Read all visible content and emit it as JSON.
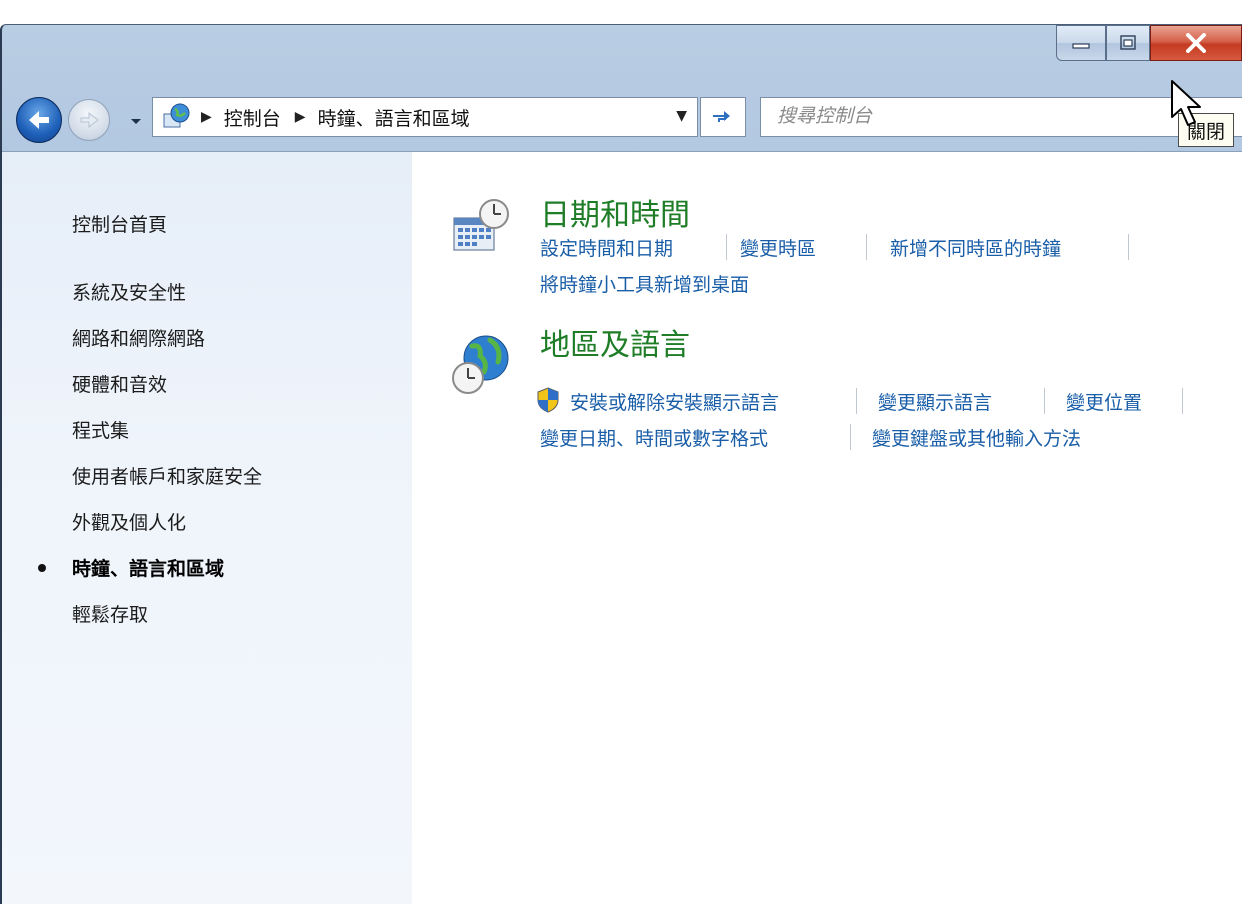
{
  "breadcrumb": {
    "items": [
      "控制台",
      "時鐘、語言和區域"
    ]
  },
  "search": {
    "placeholder": "搜尋控制台"
  },
  "tooltip": {
    "text": "關閉"
  },
  "sidebar": {
    "home": "控制台首頁",
    "items": [
      "系統及安全性",
      "網路和網際網路",
      "硬體和音效",
      "程式集",
      "使用者帳戶和家庭安全",
      "外觀及個人化",
      "時鐘、語言和區域",
      "輕鬆存取"
    ],
    "current_index": 6
  },
  "categories": [
    {
      "title": "日期和時間",
      "icon": "clock-calendar-icon",
      "links": [
        "設定時間和日期",
        "變更時區",
        "新增不同時區的時鐘",
        "將時鐘小工具新增到桌面"
      ]
    },
    {
      "title": "地區及語言",
      "icon": "globe-clock-icon",
      "links": [
        "安裝或解除安裝顯示語言",
        "變更顯示語言",
        "變更位置",
        "變更日期、時間或數字格式",
        "變更鍵盤或其他輸入方法"
      ]
    }
  ],
  "icons": {
    "back": "back-arrow-icon",
    "forward": "forward-arrow-icon",
    "refresh": "refresh-icon",
    "shield": "uac-shield-icon"
  },
  "colors": {
    "category_title": "#1e7d26",
    "task_link": "#1a5ea8",
    "close_button": "#c53a23"
  }
}
